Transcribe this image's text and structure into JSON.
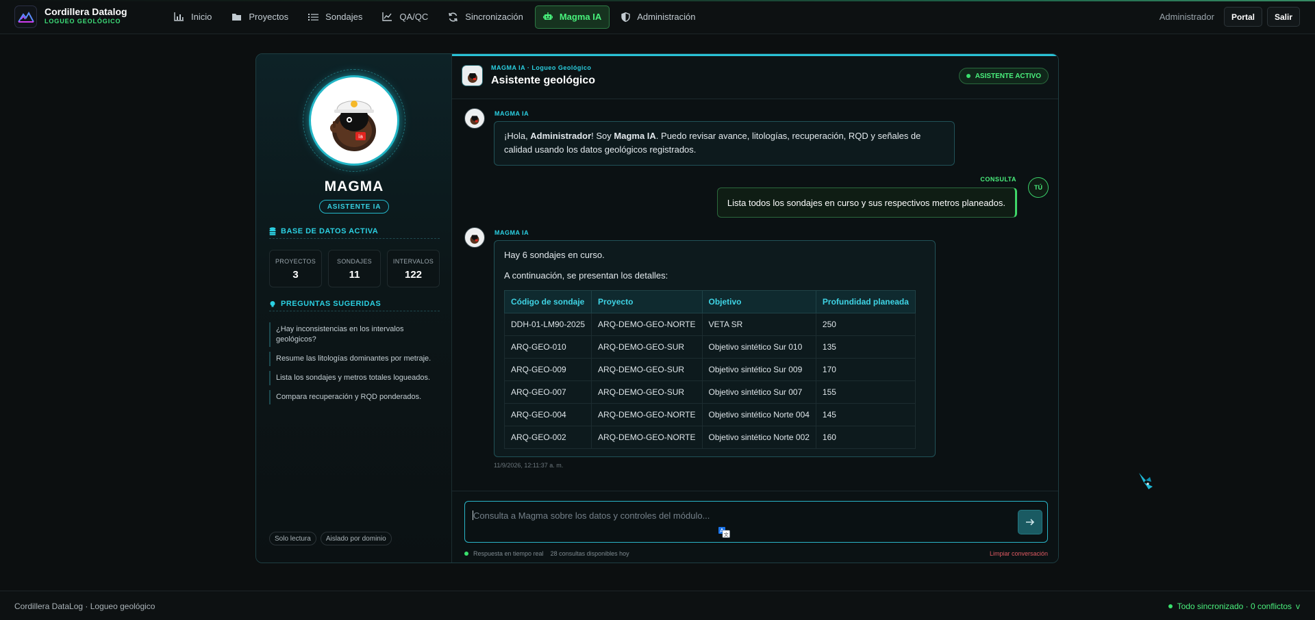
{
  "brand": {
    "name": "Cordillera Datalog",
    "subtitle": "LOGUEO GEOLÓGICO"
  },
  "nav": [
    {
      "label": "Inicio",
      "icon": "bar-chart-icon"
    },
    {
      "label": "Proyectos",
      "icon": "folder-icon"
    },
    {
      "label": "Sondajes",
      "icon": "list-icon"
    },
    {
      "label": "QA/QC",
      "icon": "line-chart-icon"
    },
    {
      "label": "Sincronización",
      "icon": "sync-icon"
    },
    {
      "label": "Magma IA",
      "icon": "robot-icon",
      "active": true
    },
    {
      "label": "Administración",
      "icon": "shield-icon"
    }
  ],
  "user": {
    "name": "Administrador",
    "portal_label": "Portal",
    "logout_label": "Salir"
  },
  "assistant": {
    "name": "MAGMA",
    "badge": "ASISTENTE IA",
    "db_title": "BASE DE DATOS ACTIVA",
    "stats": [
      {
        "label": "PROYECTOS",
        "value": "3"
      },
      {
        "label": "SONDAJES",
        "value": "11"
      },
      {
        "label": "INTERVALOS",
        "value": "122"
      }
    ],
    "suggestions_title": "PREGUNTAS SUGERIDAS",
    "suggestions": [
      "¿Hay inconsistencias en los intervalos geológicos?",
      "Resume las litologías dominantes por metraje.",
      "Lista los sondajes y metros totales logueados.",
      "Compara recuperación y RQD ponderados."
    ],
    "chips": [
      "Solo lectura",
      "Aislado por dominio"
    ]
  },
  "chat": {
    "kicker": "MAGMA IA · Logueo Geológico",
    "title": "Asistente geológico",
    "status": "ASISTENTE ACTIVO",
    "bot_label": "MAGMA IA",
    "user_label": "CONSULTA",
    "user_avatar": "TÚ",
    "greeting": {
      "p1": "¡Hola, ",
      "user": "Administrador",
      "p2": "! Soy ",
      "bot": "Magma IA",
      "p3": ". Puedo revisar avance, litologías, recuperación, RQD y señales de calidad usando los datos geológicos registrados."
    },
    "user_message": "Lista todos los sondajes en curso y sus respectivos metros planeados.",
    "answer_line1": "Hay 6 sondajes en curso.",
    "answer_line2": "A continuación, se presentan los detalles:",
    "table": {
      "headers": [
        "Código de sondaje",
        "Proyecto",
        "Objetivo",
        "Profundidad planeada"
      ],
      "rows": [
        [
          "DDH-01-LM90-2025",
          "ARQ-DEMO-GEO-NORTE",
          "VETA SR",
          "250"
        ],
        [
          "ARQ-GEO-010",
          "ARQ-DEMO-GEO-SUR",
          "Objetivo sintético Sur 010",
          "135"
        ],
        [
          "ARQ-GEO-009",
          "ARQ-DEMO-GEO-SUR",
          "Objetivo sintético Sur 009",
          "170"
        ],
        [
          "ARQ-GEO-007",
          "ARQ-DEMO-GEO-SUR",
          "Objetivo sintético Sur 007",
          "155"
        ],
        [
          "ARQ-GEO-004",
          "ARQ-DEMO-GEO-NORTE",
          "Objetivo sintético Norte 004",
          "145"
        ],
        [
          "ARQ-GEO-002",
          "ARQ-DEMO-GEO-NORTE",
          "Objetivo sintético Norte 002",
          "160"
        ]
      ]
    },
    "timestamp": "11/9/2026, 12:11:37 a. m.",
    "input_placeholder": "Consulta a Magma sobre los datos y controles del módulo...",
    "realtime": "Respuesta en tiempo real",
    "quota": "28 consultas disponibles hoy",
    "clear": "Limpiar conversación"
  },
  "footer": {
    "left": "Cordillera DataLog · Logueo geológico",
    "right": "Todo sincronizado · 0 conflictos",
    "chevron": "v"
  },
  "colors": {
    "accent": "#2bd0e2",
    "success": "#4af07d",
    "danger": "#e05a63"
  }
}
